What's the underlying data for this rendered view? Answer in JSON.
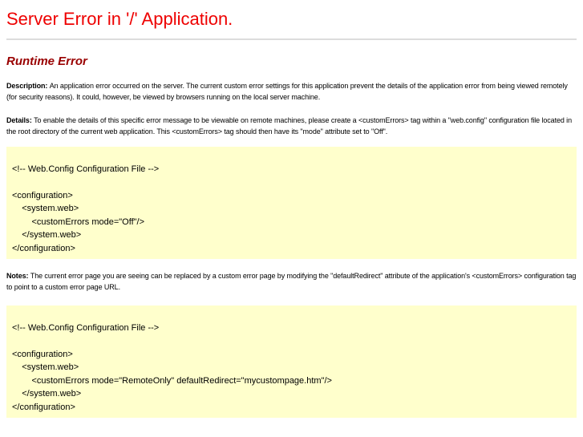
{
  "page": {
    "title": "Server Error in '/' Application.",
    "heading": "Runtime Error"
  },
  "paragraphs": {
    "description": {
      "label": "Description: ",
      "text": "An application error occurred on the server. The current custom error settings for this application prevent the details of the application error from being viewed remotely (for security reasons). It could, however, be viewed by browsers running on the local server machine."
    },
    "details": {
      "label": "Details: ",
      "text": "To enable the details of this specific error message to be viewable on remote machines, please create a <customErrors> tag within a \"web.config\" configuration file located in the root directory of the current web application. This <customErrors> tag should then have its \"mode\" attribute set to \"Off\"."
    },
    "notes": {
      "label": "Notes: ",
      "text": "The current error page you are seeing can be replaced by a custom error page by modifying the \"defaultRedirect\" attribute of the application's <customErrors> configuration tag to point to a custom error page URL."
    }
  },
  "code_blocks": {
    "custom_errors_off": "\n<!-- Web.Config Configuration File -->\n\n<configuration>\n    <system.web>\n        <customErrors mode=\"Off\"/>\n    </system.web>\n</configuration>",
    "custom_errors_remote_only": "\n<!-- Web.Config Configuration File -->\n\n<configuration>\n    <system.web>\n        <customErrors mode=\"RemoteOnly\" defaultRedirect=\"mycustompage.htm\"/>\n    </system.web>\n</configuration>"
  },
  "colors": {
    "title_red": "#ee0000",
    "heading_maroon": "#990000",
    "code_background": "#ffffcc",
    "divider_gray": "#dcdcdc"
  }
}
